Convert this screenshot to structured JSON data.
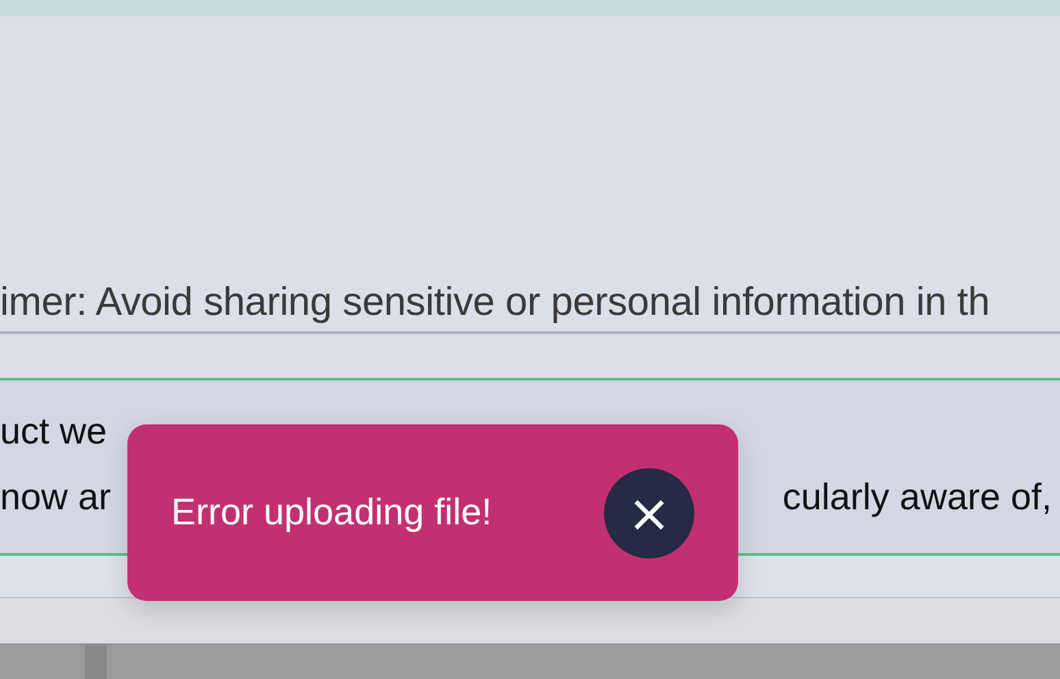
{
  "disclaimer": "imer: Avoid sharing sensitive or personal information in th",
  "message_lines": [
    {
      "left": "uct we"
    },
    {
      "left": "now ar",
      "right": "cularly aware of,"
    }
  ],
  "toast": {
    "kind": "error",
    "text": "Error uploading file!",
    "close": "×"
  }
}
